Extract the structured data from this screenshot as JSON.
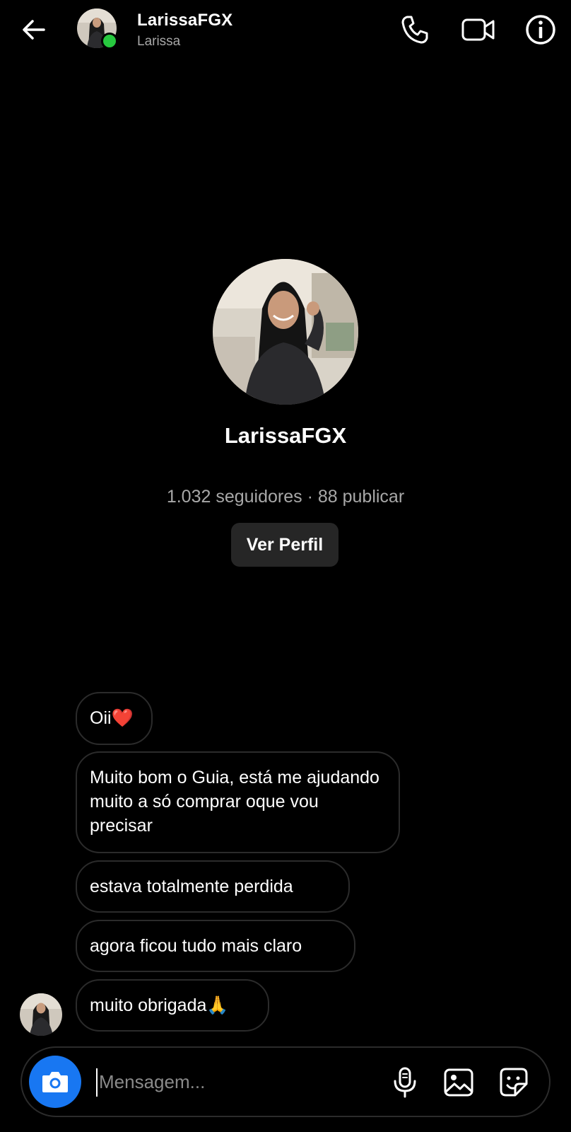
{
  "header": {
    "username": "LarissaFGX",
    "display_name": "Larissa",
    "status": "online"
  },
  "icons": {
    "back": "back-arrow-icon",
    "call": "phone-icon",
    "video": "video-camera-icon",
    "info": "info-icon",
    "camera": "camera-icon",
    "mic": "microphone-icon",
    "gallery": "image-icon",
    "sticker": "sticker-icon"
  },
  "profile": {
    "name": "LarissaFGX",
    "stats": "1.032 seguidores · 88 publicar",
    "view_profile_label": "Ver Perfil"
  },
  "messages": [
    {
      "text": "Oii",
      "emoji": "❤️"
    },
    {
      "text": "Muito bom o Guia, está me ajudando muito a só comprar oque vou precisar",
      "emoji": ""
    },
    {
      "text": "estava totalmente perdida",
      "emoji": ""
    },
    {
      "text": "agora ficou tudo mais claro",
      "emoji": ""
    },
    {
      "text": "muito obrigada",
      "emoji": "🙏"
    }
  ],
  "composer": {
    "placeholder": "Mensagem..."
  },
  "colors": {
    "background": "#000000",
    "accent": "#1877f2",
    "online": "#27c93f",
    "button_bg": "#262626",
    "secondary_text": "#a8a8a8"
  }
}
